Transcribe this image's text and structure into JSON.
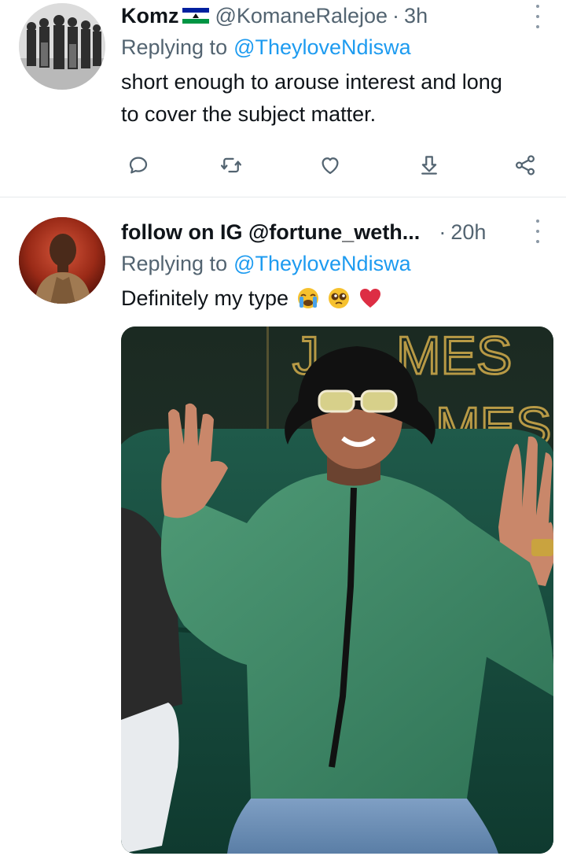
{
  "tweets": [
    {
      "name": "Komz",
      "handle": "@KomaneRalejoe",
      "separator": "·",
      "time": "3h",
      "replying_label": "Replying to",
      "replying_to": "@TheyloveNdiswa",
      "text_lines": [
        "short enough to arouse interest and long",
        "to cover the subject matter."
      ],
      "actions": [
        "reply-icon",
        "retweet-icon",
        "like-icon",
        "share-icon",
        "share-network-icon"
      ]
    },
    {
      "name": "follow on IG @fortune_weth...",
      "separator": "·",
      "time": "20h",
      "replying_label": "Replying to",
      "replying_to": "@TheyloveNdiswa",
      "text": "Definitely my type",
      "emojis": [
        "crying-face-emoji",
        "pleading-face-emoji",
        "red-heart-emoji"
      ],
      "media_wall_letters": [
        "J",
        "MES",
        "MES"
      ]
    }
  ],
  "colors": {
    "accent": "#1d9bf0",
    "secondary_text": "#536471",
    "primary_text": "#0f1419",
    "divider": "#e6e9eb"
  }
}
